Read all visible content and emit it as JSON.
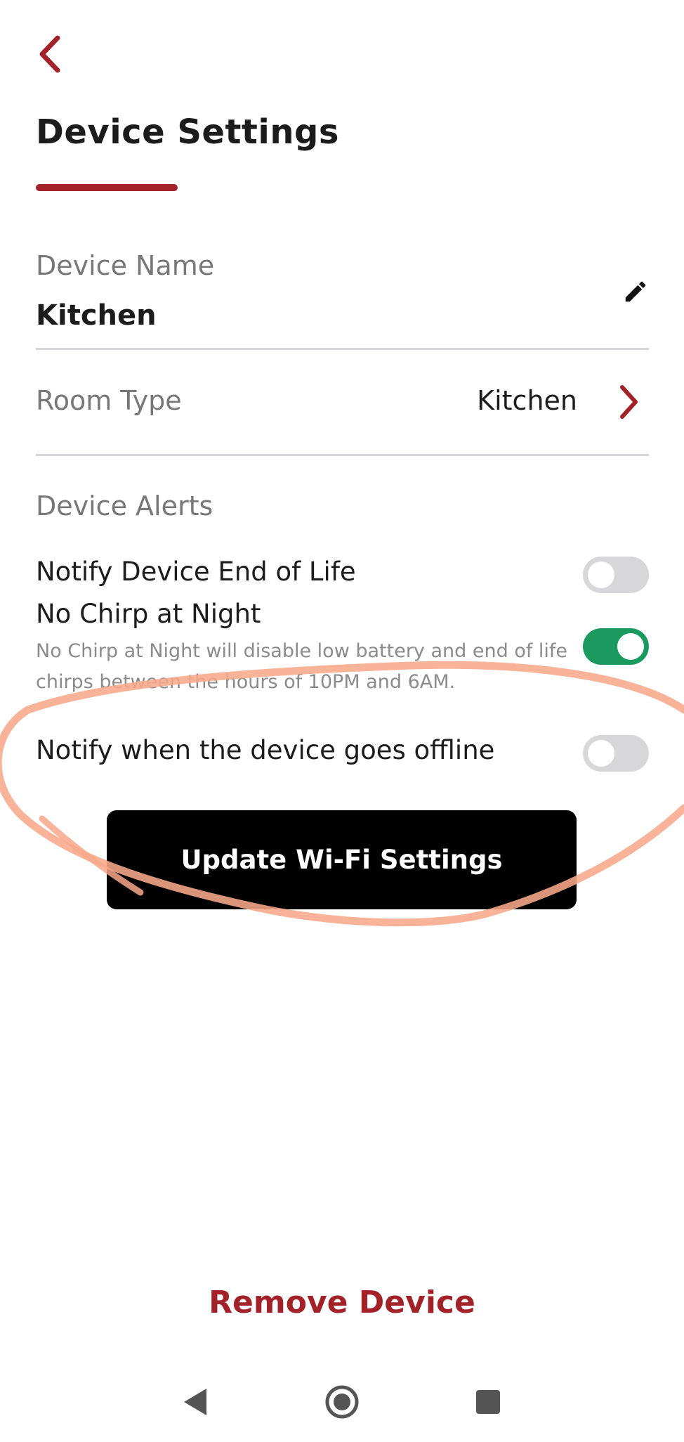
{
  "header": {
    "back_icon": "chevron-left-icon",
    "title": "Device Settings",
    "accent_color": "#a3222a"
  },
  "device_name": {
    "label": "Device Name",
    "value": "Kitchen",
    "edit_icon": "pencil-icon"
  },
  "room_type": {
    "label": "Room Type",
    "value": "Kitchen",
    "chevron_icon": "chevron-right-icon"
  },
  "alerts": {
    "header": "Device Alerts",
    "items": [
      {
        "label": "Notify Device End of Life",
        "enabled": false
      },
      {
        "label": "No Chirp at Night",
        "enabled": true,
        "description": "No Chirp at Night will disable low battery and end of life chirps between the hours of 10PM and 6AM."
      },
      {
        "label": "Notify when the device goes offline",
        "enabled": false
      }
    ],
    "toggle_on_color": "#1a9a5f",
    "toggle_off_color": "#d7d7d9"
  },
  "wifi_button": {
    "label": "Update Wi-Fi Settings"
  },
  "remove_button": {
    "label": "Remove Device"
  },
  "nav": {
    "back_icon": "triangle-back-icon",
    "home_icon": "circle-home-icon",
    "recents_icon": "square-recents-icon"
  },
  "annotation_color": "#f7a88a"
}
